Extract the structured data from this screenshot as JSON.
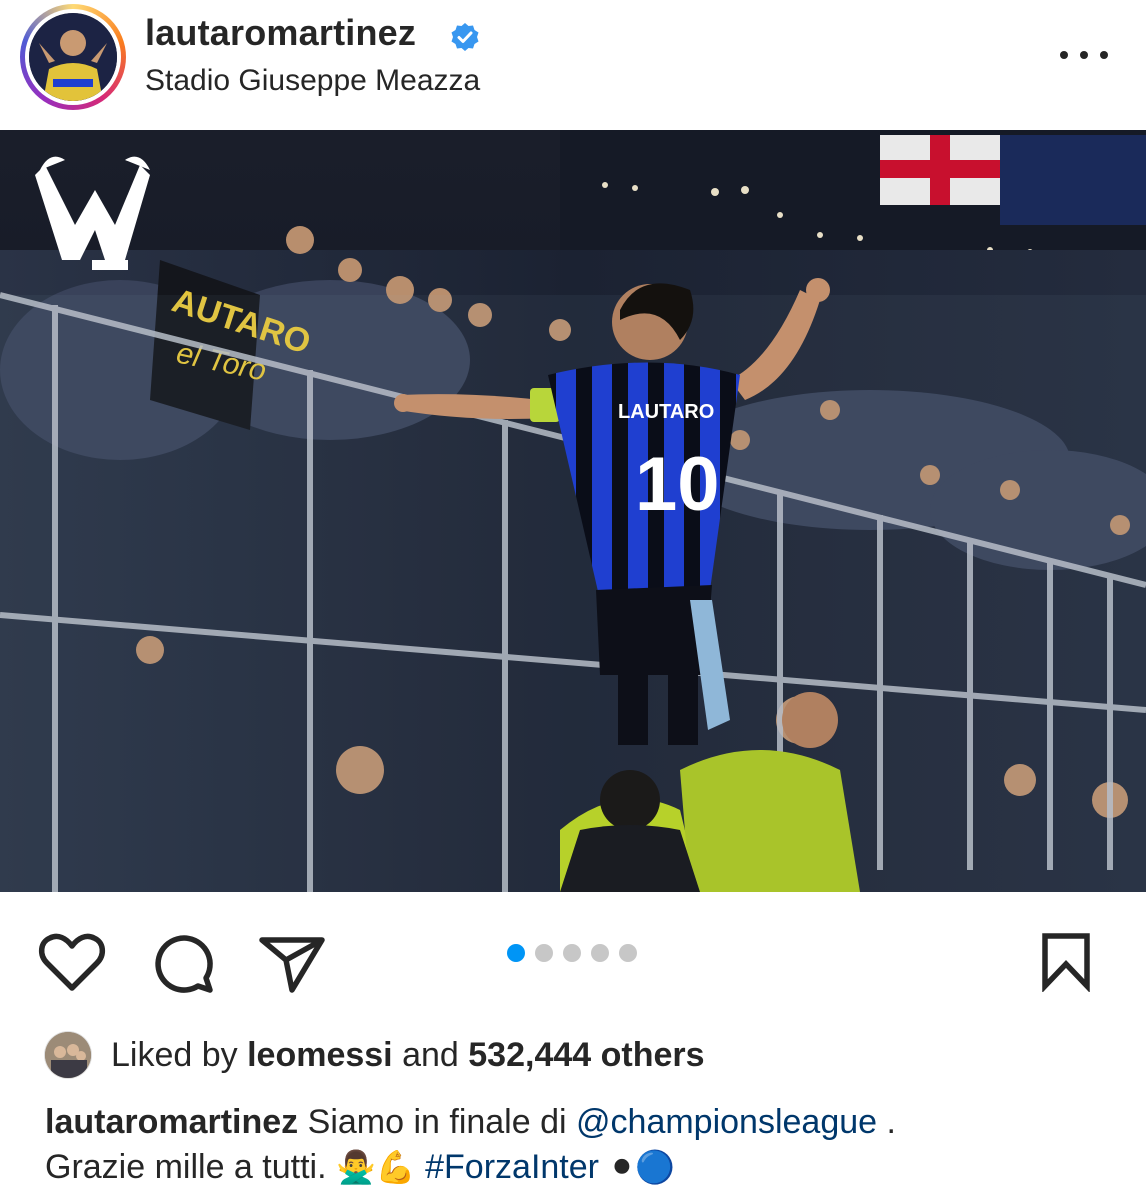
{
  "post": {
    "header": {
      "username": "lautaromartinez",
      "verified": true,
      "location": "Stadio Giuseppe Meazza",
      "more_icon": "more-horizontal-icon"
    },
    "photo": {
      "watermark_logo": "LM",
      "banner_text_1": "AUTARO",
      "banner_text_2": "el Toro",
      "jersey_name": "LAUTARO",
      "jersey_number": "10"
    },
    "actions": {
      "like_icon": "heart-icon",
      "comment_icon": "comment-icon",
      "share_icon": "paper-plane-icon",
      "save_icon": "bookmark-icon",
      "carousel_count": 5,
      "carousel_active_index": 0
    },
    "likes": {
      "prefix": "Liked by",
      "liked_by_user": "leomessi",
      "conjunction": "and",
      "others_count": "532,444 others"
    },
    "caption": {
      "author": "lautaromartinez",
      "text_1": "Siamo in finale di",
      "mention": "@championsleague",
      "text_2": ".",
      "text_3": "Grazie mille a tutti.",
      "emoji_1": "🙅‍♂️",
      "emoji_2": "💪",
      "hashtag": "#ForzaInter",
      "emoji_3": "⚫",
      "emoji_4": "🔵"
    },
    "colors": {
      "link": "#00376b",
      "carousel_active": "#0095f6",
      "verified_badge": "#3897f0",
      "jersey_blue": "#1f3fd0"
    }
  }
}
